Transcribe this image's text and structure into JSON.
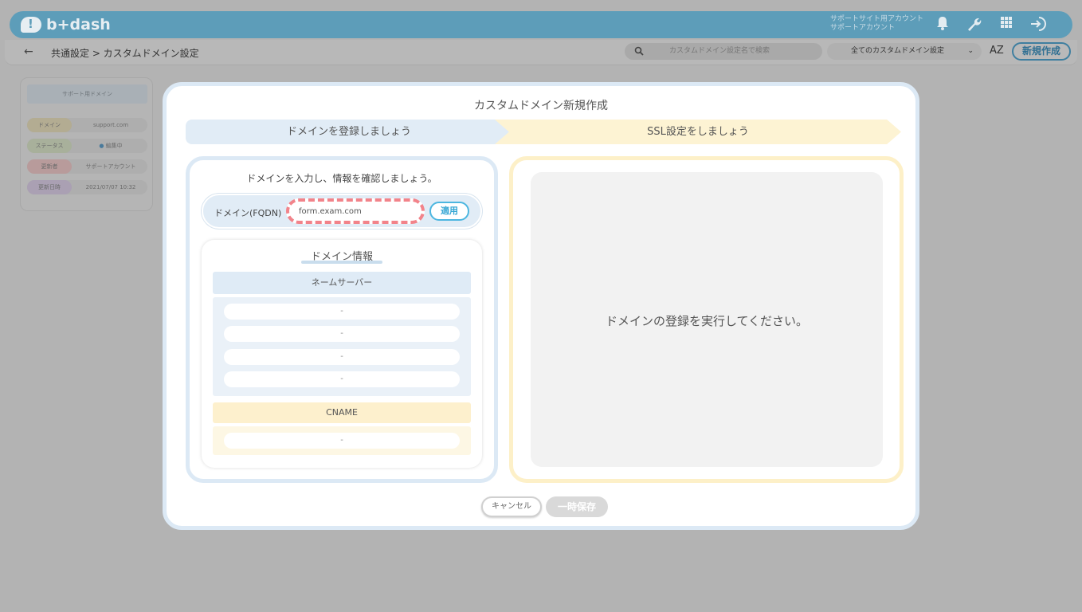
{
  "app": {
    "logo_text": "b+dash",
    "user_line1": "サポートサイト用アカウント",
    "user_line2": "サポートアカウント"
  },
  "header_icons": [
    "bell-icon",
    "wrench-icon",
    "grid-icon",
    "logout-icon"
  ],
  "breadcrumb": "共通設定 > カスタムドメイン設定",
  "search": {
    "placeholder": "カスタムドメイン設定名で検索"
  },
  "filter": {
    "value": "全てのカスタムドメイン設定"
  },
  "sort_label": "AZ",
  "new_button": "新規作成",
  "side_card": {
    "title": "サポート用ドメイン",
    "rows": [
      {
        "label": "ドメイン",
        "value": "support.com",
        "color": "#b3ac92"
      },
      {
        "label": "ステータス",
        "value": "編集中",
        "color": "#a8b09b"
      },
      {
        "label": "更新者",
        "value": "サポートアカウント",
        "color": "#b89b9b"
      },
      {
        "label": "更新日時",
        "value": "2021/07/07 10:32",
        "color": "#aaa0b3"
      }
    ]
  },
  "modal": {
    "title": "カスタムドメイン新規作成",
    "step1": "ドメインを登録しましょう",
    "step2": "SSL設定をしましょう",
    "left": {
      "heading": "ドメインを入力し、情報を確認しましょう。",
      "domain_label": "ドメイン(FQDN)",
      "domain_value": "form.exam.com",
      "apply": "適用",
      "info_title": "ドメイン情報",
      "ns_header": "ネームサーバー",
      "ns_items": [
        "-",
        "-",
        "-",
        "-"
      ],
      "cname_header": "CNAME",
      "cname_item": "-"
    },
    "right_message": "ドメインの登録を実行してください。",
    "cancel": "キャンセル",
    "save": "一時保存"
  },
  "colors": {
    "header": "#5d9db9",
    "step1": "#e1ecf6",
    "step2": "#fdf3d3",
    "dashed_highlight": "#f2838a",
    "apply": "#35a6d4"
  }
}
